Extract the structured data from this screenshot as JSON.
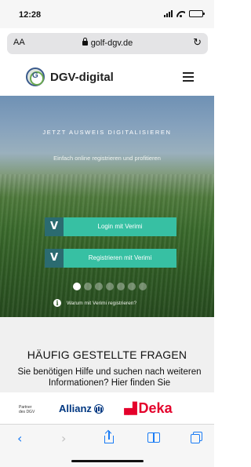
{
  "status_bar": {
    "time": "12:28"
  },
  "browser": {
    "aa_label": "AA",
    "url": "golf-dgv.de"
  },
  "site": {
    "name": "DGV-digital"
  },
  "hero": {
    "tagline": "JETZT AUSWEIS DIGITALISIEREN",
    "subtitle": "Einfach online registrieren und profitieren",
    "login_button": "Login mit Verimi",
    "register_button": "Registrieren mit Verimi",
    "button_logo": "V",
    "info_icon": "i",
    "info_text": "Warum mit Verimi registrieren?",
    "carousel_total": 7,
    "carousel_active": 1
  },
  "faq": {
    "title": "HÄUFIG GESTELLTE FRAGEN",
    "text": "Sie benötigen Hilfe und suchen nach weiteren Informationen? Hier finden Sie"
  },
  "sponsors": {
    "partner_line1": "Partner",
    "partner_line2": "des DGV",
    "allianz": "Allianz",
    "deka": "Deka"
  },
  "colors": {
    "accent": "#37c0a3",
    "accent_dark": "#2b6b70",
    "safari_blue": "#1a7cf5",
    "allianz_blue": "#003781",
    "deka_red": "#e4002b"
  },
  "icons": {
    "back": "chevron-left-icon",
    "forward": "chevron-right-icon",
    "share": "share-icon",
    "bookmarks": "book-icon",
    "tabs": "tabs-icon"
  }
}
